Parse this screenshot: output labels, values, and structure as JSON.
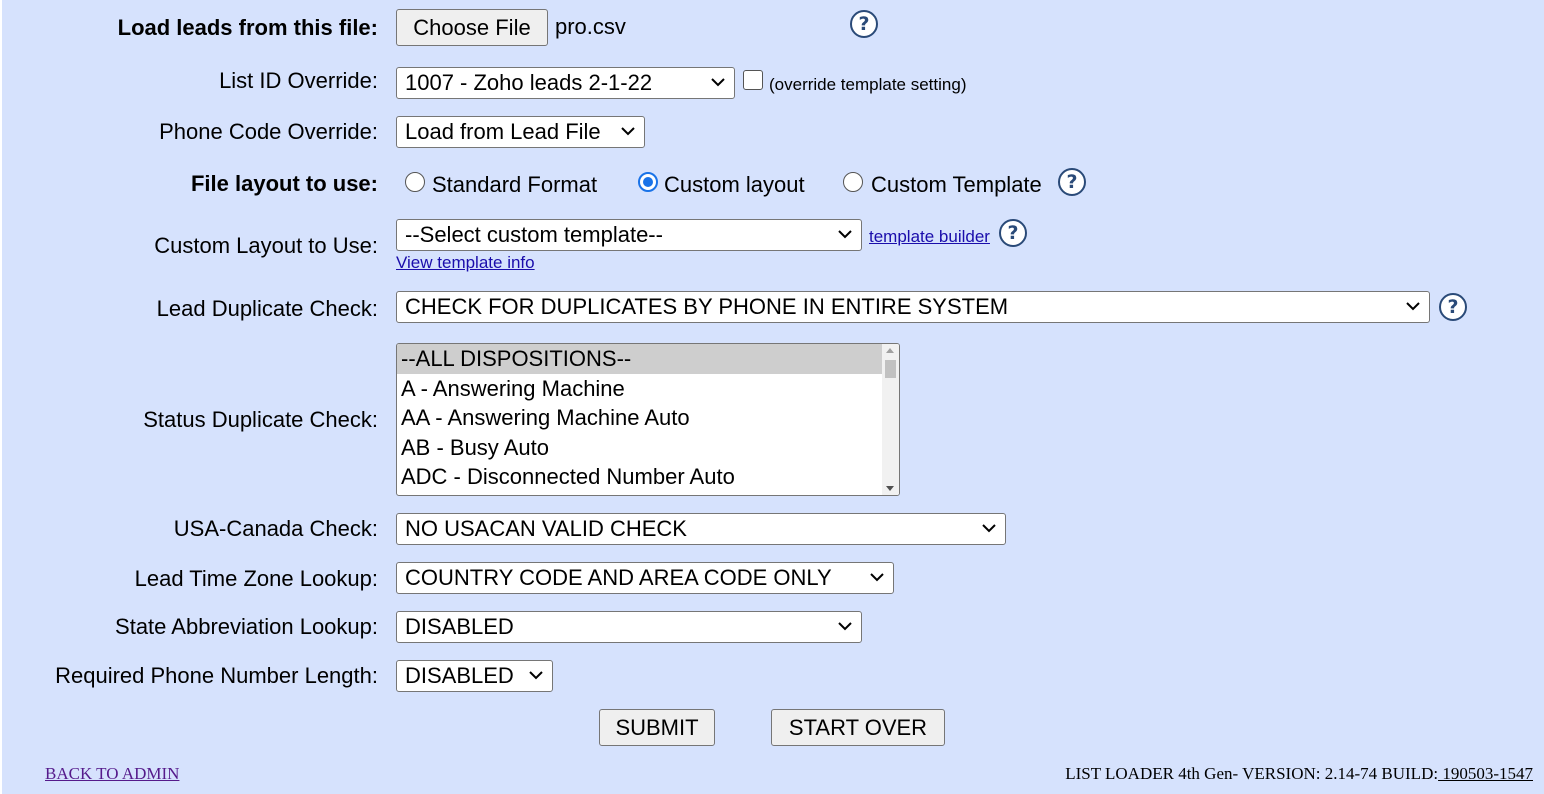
{
  "rows": {
    "load_file": {
      "label": "Load leads from this file:",
      "choose_button": "Choose File",
      "file_name": "pro.csv",
      "help": "?"
    },
    "list_id": {
      "label": "List ID Override:",
      "selected": "1007 - Zoho leads 2-1-22",
      "checkbox_label": "(override template setting)",
      "checked": false
    },
    "phone_code": {
      "label": "Phone Code Override:",
      "selected": "Load from Lead File"
    },
    "file_layout": {
      "label": "File layout to use:",
      "options": [
        {
          "label": "Standard Format",
          "checked": false
        },
        {
          "label": "Custom layout",
          "checked": true
        },
        {
          "label": "Custom Template",
          "checked": false
        }
      ],
      "help": "?"
    },
    "custom_layout": {
      "label": "Custom Layout to Use:",
      "selected": "--Select custom template--",
      "builder_link": "template builder",
      "info_link": "View template info",
      "help": "?"
    },
    "lead_dup": {
      "label": "Lead Duplicate Check:",
      "selected": "CHECK FOR DUPLICATES BY PHONE IN ENTIRE SYSTEM",
      "help": "?"
    },
    "status_dup": {
      "label": "Status Duplicate Check:",
      "options": [
        "--ALL DISPOSITIONS--",
        "A - Answering Machine",
        "AA - Answering Machine Auto",
        "AB - Busy Auto",
        "ADC - Disconnected Number Auto"
      ],
      "selected_index": 0
    },
    "usa_canada": {
      "label": "USA-Canada Check:",
      "selected": "NO USACAN VALID CHECK"
    },
    "time_zone": {
      "label": "Lead Time Zone Lookup:",
      "selected": "COUNTRY CODE AND AREA CODE ONLY"
    },
    "state_abbr": {
      "label": "State Abbreviation Lookup:",
      "selected": "DISABLED"
    },
    "phone_length": {
      "label": "Required Phone Number Length:",
      "selected": "DISABLED"
    }
  },
  "buttons": {
    "submit": "SUBMIT",
    "start_over": "START OVER"
  },
  "footer": {
    "back_link": "BACK TO ADMIN",
    "version_text": "LIST LOADER 4th Gen- VERSION: 2.14-74 BUILD:",
    "build_link": " 190503-1547"
  },
  "colors": {
    "background": "#d6e2fd",
    "link": "#1a0dab",
    "radio_accent": "#1a73e8"
  }
}
